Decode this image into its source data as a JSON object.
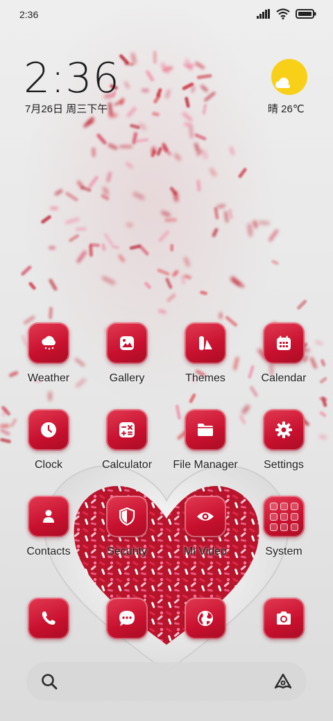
{
  "status_bar": {
    "time": "2:36",
    "icons": [
      "signal-icon",
      "wifi-icon",
      "battery-icon"
    ]
  },
  "clock_widget": {
    "time": "2:36",
    "date": "7月26日 周三下午"
  },
  "weather_widget": {
    "text": "晴 26℃",
    "icon": "partly-sunny-icon",
    "sun_color": "#f9d018"
  },
  "apps": [
    {
      "label": "Weather",
      "icon": "weather-icon"
    },
    {
      "label": "Gallery",
      "icon": "gallery-icon"
    },
    {
      "label": "Themes",
      "icon": "themes-icon"
    },
    {
      "label": "Calendar",
      "icon": "calendar-icon"
    },
    {
      "label": "Clock",
      "icon": "clock-icon"
    },
    {
      "label": "Calculator",
      "icon": "calculator-icon"
    },
    {
      "label": "File Manager",
      "icon": "folder-icon"
    },
    {
      "label": "Settings",
      "icon": "gear-icon"
    },
    {
      "label": "Contacts",
      "icon": "contacts-icon"
    },
    {
      "label": "Security",
      "icon": "shield-icon"
    },
    {
      "label": "Mi Video",
      "icon": "eye-icon"
    },
    {
      "label": "System",
      "icon": "folder-grid-icon"
    }
  ],
  "dock": [
    {
      "icon": "phone-icon"
    },
    {
      "icon": "messages-icon"
    },
    {
      "icon": "browser-globe-icon"
    },
    {
      "icon": "camera-icon"
    }
  ],
  "search_bar": {
    "left_icon": "search-icon",
    "right_icon": "assistant-icon"
  },
  "theme": {
    "icon_color": "#c8102e",
    "icon_glyph_color": "#ffffff"
  }
}
